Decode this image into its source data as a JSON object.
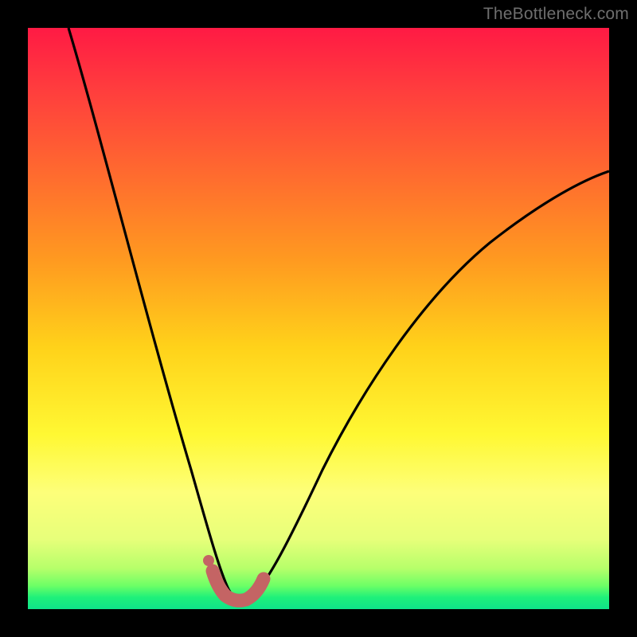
{
  "watermark": "TheBottleneck.com",
  "colors": {
    "background": "#000000",
    "gradient_top": "#ff1a44",
    "gradient_mid": "#ffd21a",
    "gradient_bottom": "#0fe38a",
    "curve": "#000000",
    "marker": "#c46464"
  },
  "chart_data": {
    "type": "line",
    "title": "",
    "xlabel": "",
    "ylabel": "",
    "xlim": [
      0,
      100
    ],
    "ylim": [
      0,
      100
    ],
    "series": [
      {
        "name": "bottleneck-curve",
        "x": [
          7,
          10,
          13,
          16,
          19,
          22,
          25,
          27,
          29,
          31,
          33,
          34.5,
          36,
          38,
          40,
          43,
          47,
          52,
          58,
          65,
          73,
          82,
          92,
          100
        ],
        "values": [
          100,
          86,
          72,
          59,
          47,
          36,
          26,
          19,
          13,
          8,
          4,
          2,
          1.5,
          2,
          4,
          8,
          15,
          24,
          34,
          44,
          53,
          61,
          68,
          73
        ]
      },
      {
        "name": "highlighted-minimum",
        "x": [
          31.5,
          33,
          34.5,
          36,
          37.5,
          39,
          40.5
        ],
        "values": [
          6,
          3,
          1.8,
          1.5,
          1.8,
          3,
          5.5
        ]
      }
    ],
    "annotations": [
      {
        "type": "point",
        "x": 31,
        "y": 8,
        "label": ""
      }
    ]
  }
}
